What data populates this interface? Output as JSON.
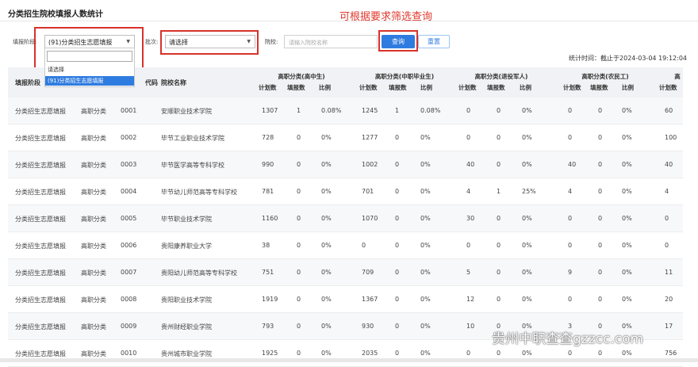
{
  "page": {
    "title": "分类招生院校填报人数统计",
    "annotation": "可根据要求筛选查询",
    "watermark": "贵州中职查查gzzcc.com"
  },
  "filters": {
    "stage_label": "填报阶段:",
    "stage_value": "(91)分类招生志愿填报",
    "batch_label": "批次:",
    "batch_value": "请选择",
    "school_label": "院校:",
    "school_placeholder": "请输入院校名称",
    "query_button": "查询",
    "reset_button": "重置"
  },
  "dropdown": {
    "options": [
      "请选择",
      "(91)分类招生志愿填报"
    ],
    "selected": "(91)分类招生志愿填报"
  },
  "stat_time": "统计时间：截止于2024-03-04 19:12:04",
  "table": {
    "headers": {
      "stage": "填报阶段",
      "batch": "批次",
      "code": "代码",
      "school": "院校名称"
    },
    "groups": [
      {
        "name": "高职分类(高中生)",
        "subs": [
          "计划数",
          "填报数",
          "比例"
        ]
      },
      {
        "name": "高职分类(中职毕业生)",
        "subs": [
          "计划数",
          "填报数",
          "比例"
        ]
      },
      {
        "name": "高职分类(退役军人)",
        "subs": [
          "计划数",
          "填报数",
          "比例"
        ]
      },
      {
        "name": "高职分类(农民工)",
        "subs": [
          "计划数",
          "填报数",
          "比例"
        ]
      },
      {
        "name": "高",
        "subs": [
          "计划数"
        ]
      }
    ],
    "rows": [
      {
        "stage": "分类招生志愿填报",
        "batch": "高职分类",
        "code": "0001",
        "school": "安顺职业技术学院",
        "cells": [
          "1307",
          "1",
          "0.08%",
          "1245",
          "1",
          "0.08%",
          "0",
          "0",
          "0%",
          "0",
          "0",
          "0%",
          "60"
        ]
      },
      {
        "stage": "分类招生志愿填报",
        "batch": "高职分类",
        "code": "0002",
        "school": "毕节工业职业技术学院",
        "cells": [
          "728",
          "0",
          "0%",
          "1277",
          "0",
          "0%",
          "0",
          "0",
          "0%",
          "0",
          "0",
          "0%",
          "100"
        ]
      },
      {
        "stage": "分类招生志愿填报",
        "batch": "高职分类",
        "code": "0003",
        "school": "毕节医学高等专科学校",
        "cells": [
          "990",
          "0",
          "0%",
          "1002",
          "0",
          "0%",
          "40",
          "0",
          "0%",
          "40",
          "0",
          "0%",
          "40"
        ]
      },
      {
        "stage": "分类招生志愿填报",
        "batch": "高职分类",
        "code": "0004",
        "school": "毕节幼儿师范高等专科学校",
        "cells": [
          "781",
          "0",
          "0%",
          "701",
          "0",
          "0%",
          "4",
          "1",
          "25%",
          "4",
          "0",
          "0%",
          "4"
        ]
      },
      {
        "stage": "分类招生志愿填报",
        "batch": "高职分类",
        "code": "0005",
        "school": "毕节职业技术学院",
        "cells": [
          "1160",
          "0",
          "0%",
          "1070",
          "0",
          "0%",
          "30",
          "0",
          "0%",
          "0",
          "0",
          "0%",
          "0"
        ]
      },
      {
        "stage": "分类招生志愿填报",
        "batch": "高职分类",
        "code": "0006",
        "school": "贵阳康养职业大学",
        "cells": [
          "38",
          "0",
          "0%",
          "0",
          "0",
          "0%",
          "0",
          "0",
          "0%",
          "0",
          "0",
          "0%",
          "0"
        ]
      },
      {
        "stage": "分类招生志愿填报",
        "batch": "高职分类",
        "code": "0007",
        "school": "贵阳幼儿师范高等专科学校",
        "cells": [
          "751",
          "0",
          "0%",
          "709",
          "0",
          "0%",
          "5",
          "0",
          "0%",
          "9",
          "0",
          "0%",
          "11"
        ]
      },
      {
        "stage": "分类招生志愿填报",
        "batch": "高职分类",
        "code": "0008",
        "school": "贵阳职业技术学院",
        "cells": [
          "1919",
          "0",
          "0%",
          "1367",
          "0",
          "0%",
          "12",
          "0",
          "0%",
          "0",
          "0",
          "0%",
          "20"
        ]
      },
      {
        "stage": "分类招生志愿填报",
        "batch": "高职分类",
        "code": "0009",
        "school": "贵州财经职业学院",
        "cells": [
          "793",
          "0",
          "0%",
          "930",
          "0",
          "0%",
          "10",
          "0",
          "0%",
          "3",
          "0",
          "0%",
          "17"
        ]
      },
      {
        "stage": "分类招生志愿填报",
        "batch": "高职分类",
        "code": "0010",
        "school": "贵州城市职业学院",
        "cells": [
          "1925",
          "0",
          "0%",
          "2035",
          "0",
          "0%",
          "0",
          "0",
          "0%",
          "0",
          "0",
          "0%",
          "756"
        ]
      }
    ]
  },
  "colors": {
    "accent": "#2f7ce0",
    "highlight_frame": "#d8322b",
    "header_bg": "#f0f2f5"
  }
}
